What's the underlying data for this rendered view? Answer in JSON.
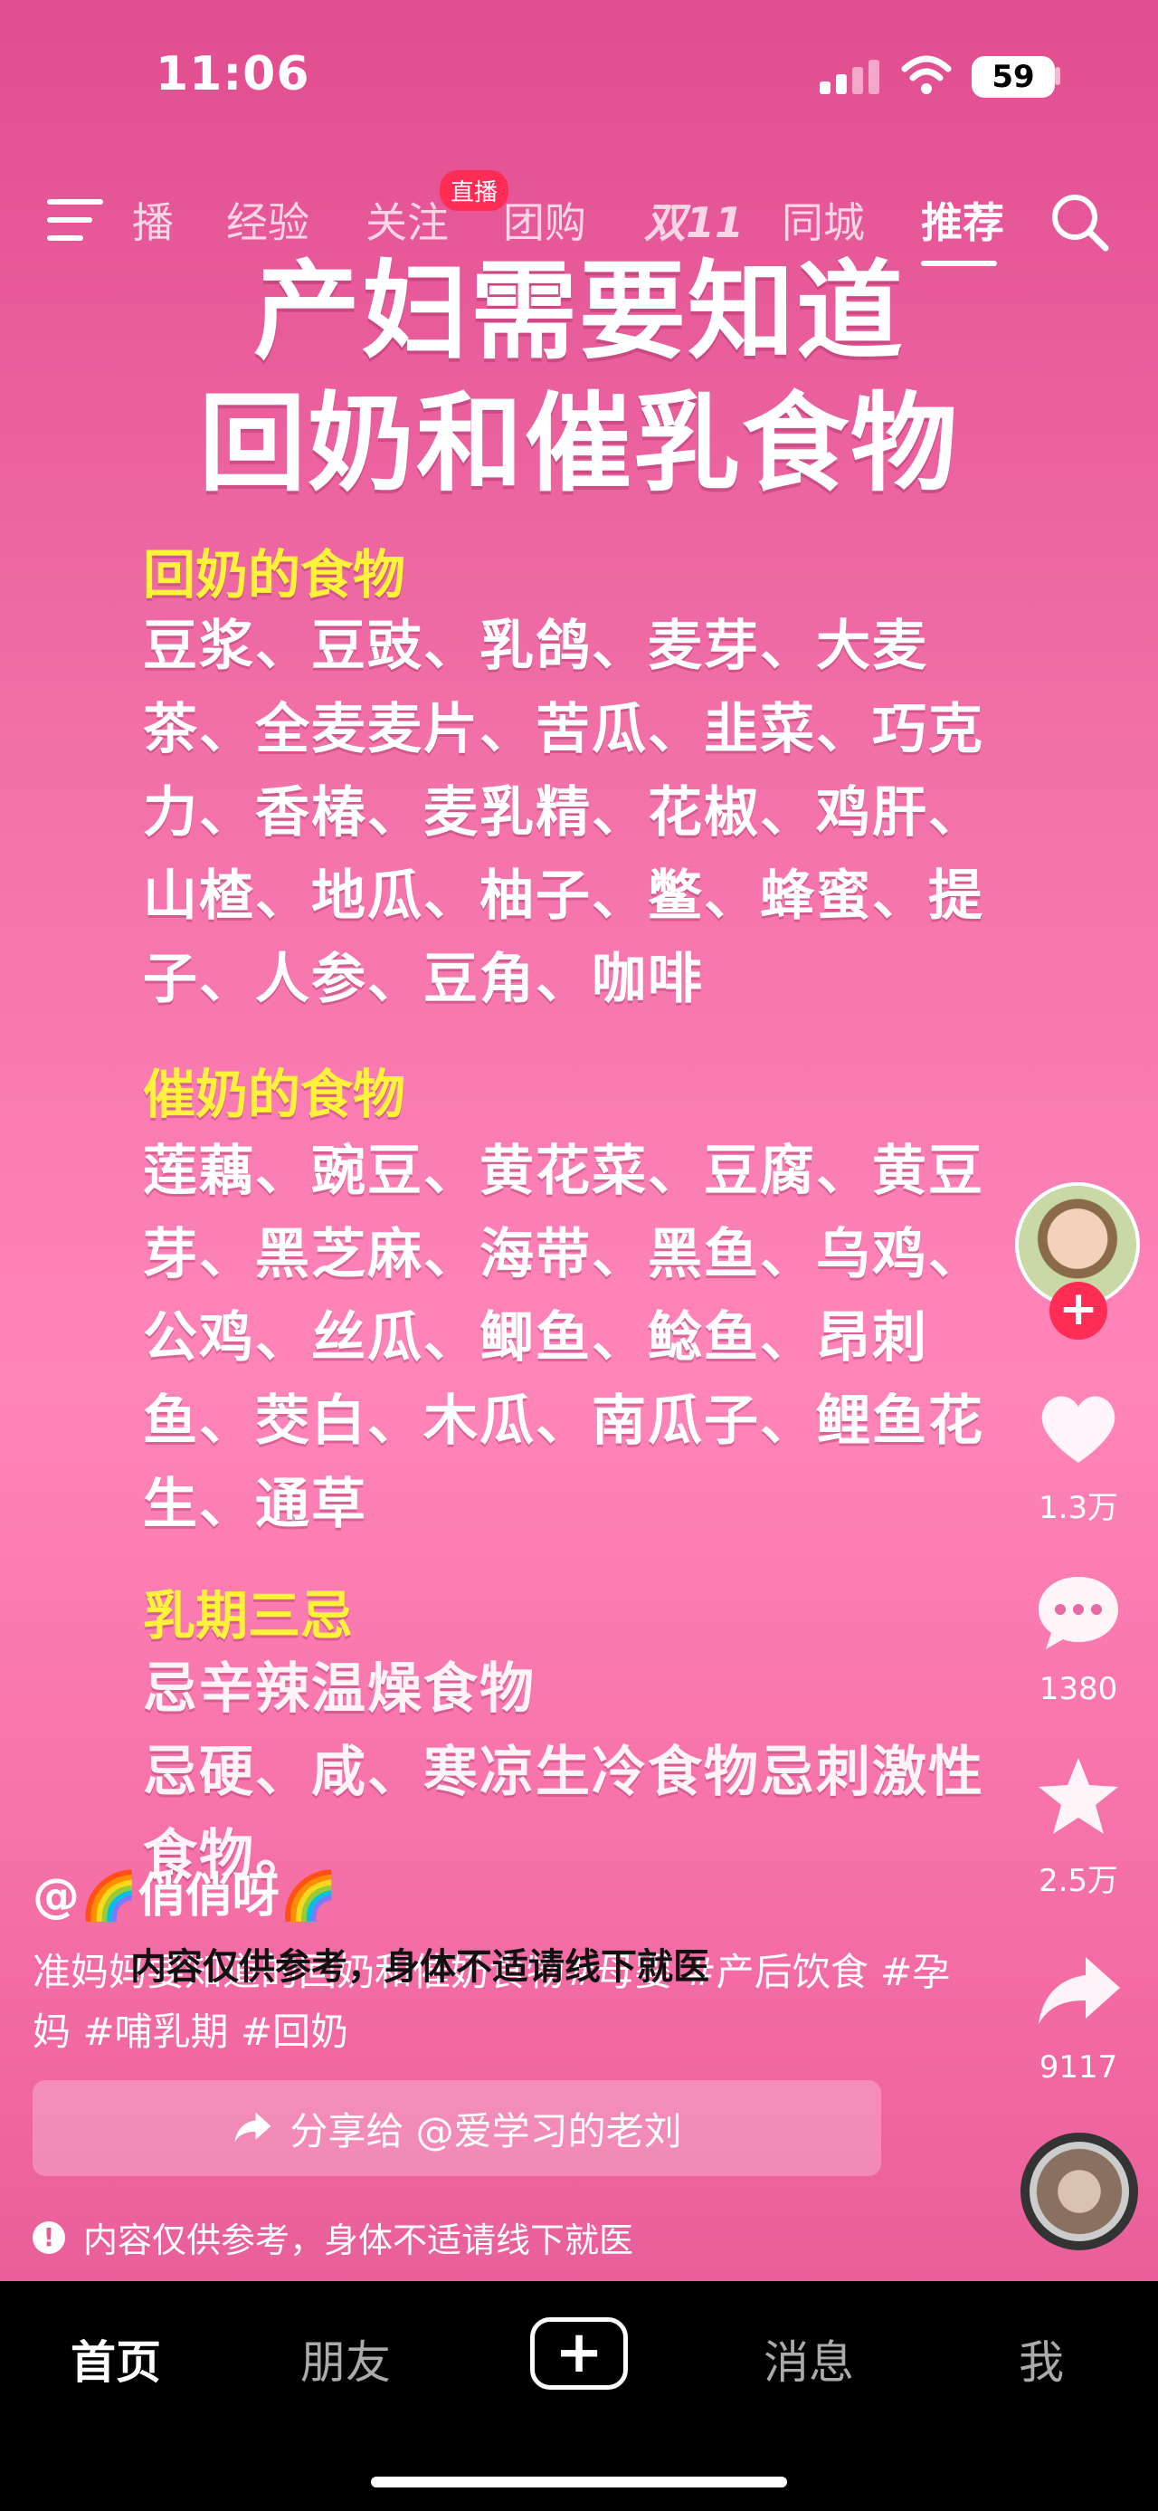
{
  "status": {
    "time": "11:06",
    "battery": "59"
  },
  "nav": {
    "tabs": [
      "播",
      "经验",
      "关注",
      "团购",
      "双11",
      "同城",
      "推荐"
    ],
    "live_badge": "直播",
    "active_tab": "推荐"
  },
  "poster": {
    "title_line1": "产妇需要知道",
    "title_line2": "回奶和催乳食物",
    "sections": [
      {
        "title": "回奶的食物",
        "body": "豆浆、豆豉、乳鸽、麦芽、大麦茶、全麦麦片、苦瓜、韭菜、巧克力、香椿、麦乳精、花椒、鸡肝、山楂、地瓜、柚子、鳖、蜂蜜、提子、人参、豆角、咖啡"
      },
      {
        "title": "催奶的食物",
        "body": "莲藕、豌豆、黄花菜、豆腐、黄豆芽、黑芝麻、海带、黑鱼、乌鸡、公鸡、丝瓜、鲫鱼、鲶鱼、昂刺鱼、茭白、木瓜、南瓜子、鲤鱼花生、通草"
      },
      {
        "title": "乳期三忌",
        "body": "忌辛辣温燥食物\n忌硬、咸、寒凉生冷食物忌刺激性食物。"
      }
    ]
  },
  "rail": {
    "likes": "1.3万",
    "comments": "1380",
    "favorites": "2.5万",
    "shares": "9117"
  },
  "caption": {
    "author": "@🌈俏俏呀🌈",
    "description": "准妈妈要知道的回奶和催奶食物#母婴 #产后饮食 #孕妈 #哺乳期 #回奶",
    "overlay_tip": "内容仅供参考，身体不适请线下就医"
  },
  "share_bar": {
    "label": "分享给 @爱学习的老刘"
  },
  "notice": {
    "text": "内容仅供参考，身体不适请线下就医"
  },
  "bottom_nav": {
    "home": "首页",
    "friends": "朋友",
    "create": "+",
    "messages": "消息",
    "me": "我"
  },
  "colors": {
    "accent_red": "#ff2c55",
    "section_yellow": "#fff23a"
  }
}
